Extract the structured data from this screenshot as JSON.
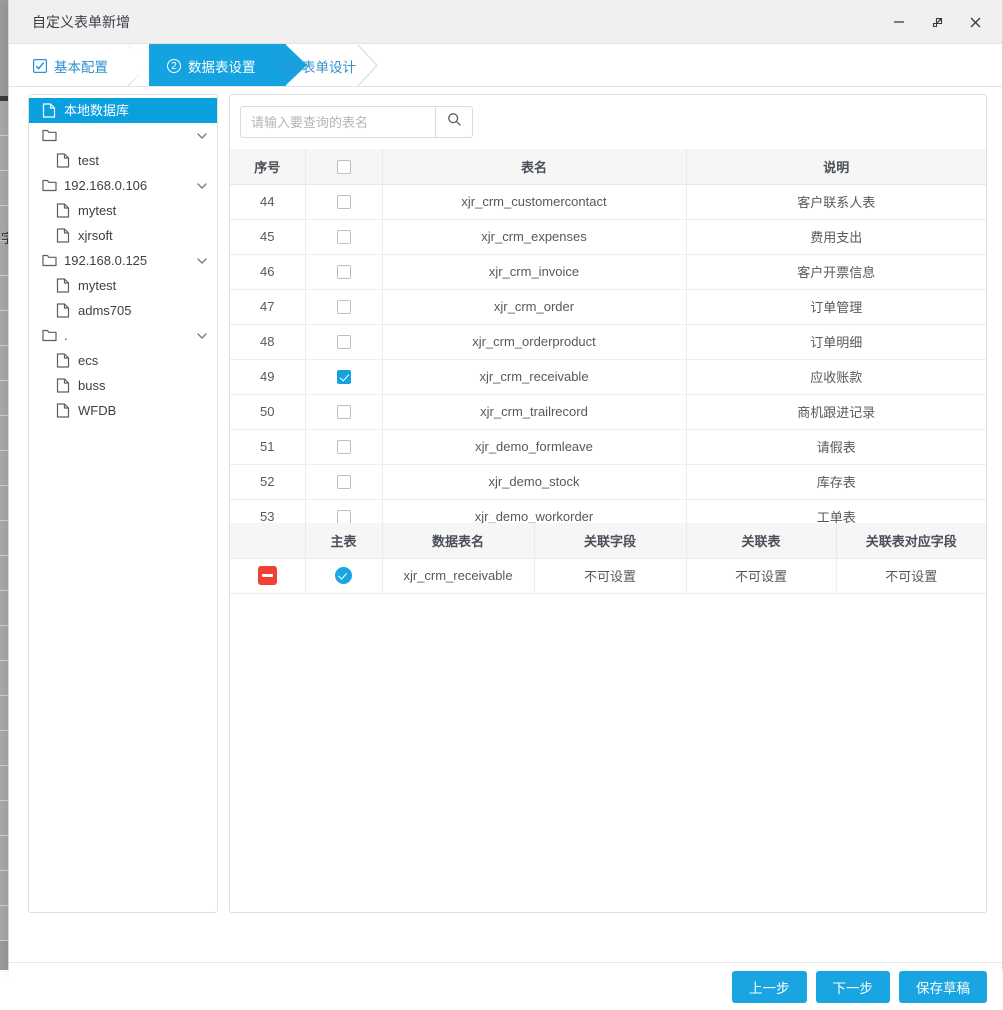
{
  "window": {
    "title": "自定义表单新增",
    "controls": [
      {
        "name": "minimize-button",
        "glyph": "minimize"
      },
      {
        "name": "maximize-button",
        "glyph": "maximize"
      },
      {
        "name": "close-button",
        "glyph": "close"
      }
    ]
  },
  "steps": [
    {
      "label": "基本配置",
      "state": "done",
      "marker": "check"
    },
    {
      "label": "数据表设置",
      "state": "active",
      "marker": "2"
    },
    {
      "label": "表单设计",
      "state": "done",
      "marker": "check"
    }
  ],
  "tree": {
    "items": [
      {
        "label": "本地数据库",
        "icon": "file-icon",
        "level": 0,
        "selected": true,
        "expandable": false
      },
      {
        "label": "",
        "icon": "folder-icon",
        "level": 0,
        "selected": false,
        "expandable": true
      },
      {
        "label": "test",
        "icon": "file-icon",
        "level": 1,
        "selected": false,
        "expandable": false
      },
      {
        "label": "192.168.0.106",
        "icon": "folder-icon",
        "level": 0,
        "selected": false,
        "expandable": true
      },
      {
        "label": "mytest",
        "icon": "file-icon",
        "level": 1,
        "selected": false,
        "expandable": false
      },
      {
        "label": "xjrsoft",
        "icon": "file-icon",
        "level": 1,
        "selected": false,
        "expandable": false
      },
      {
        "label": "192.168.0.125",
        "icon": "folder-icon",
        "level": 0,
        "selected": false,
        "expandable": true
      },
      {
        "label": "mytest",
        "icon": "file-icon",
        "level": 1,
        "selected": false,
        "expandable": false
      },
      {
        "label": "adms705",
        "icon": "file-icon",
        "level": 1,
        "selected": false,
        "expandable": false
      },
      {
        "label": ".",
        "icon": "folder-icon",
        "level": 0,
        "selected": false,
        "expandable": true
      },
      {
        "label": "ecs",
        "icon": "file-icon",
        "level": 1,
        "selected": false,
        "expandable": false
      },
      {
        "label": "buss",
        "icon": "file-icon",
        "level": 1,
        "selected": false,
        "expandable": false
      },
      {
        "label": "WFDB",
        "icon": "file-icon",
        "level": 1,
        "selected": false,
        "expandable": false
      }
    ]
  },
  "search": {
    "placeholder": "请输入要查询的表名",
    "value": "",
    "button_icon": "search-icon"
  },
  "tables_list": {
    "headers": [
      "序号",
      "",
      "表名",
      "说明"
    ],
    "header_checkbox_checked": false,
    "rows": [
      {
        "seq": "44",
        "checked": false,
        "table": "xjr_crm_customercontact",
        "desc": "客户联系人表"
      },
      {
        "seq": "45",
        "checked": false,
        "table": "xjr_crm_expenses",
        "desc": "费用支出"
      },
      {
        "seq": "46",
        "checked": false,
        "table": "xjr_crm_invoice",
        "desc": "客户开票信息"
      },
      {
        "seq": "47",
        "checked": false,
        "table": "xjr_crm_order",
        "desc": "订单管理"
      },
      {
        "seq": "48",
        "checked": false,
        "table": "xjr_crm_orderproduct",
        "desc": "订单明细"
      },
      {
        "seq": "49",
        "checked": true,
        "table": "xjr_crm_receivable",
        "desc": "应收账款"
      },
      {
        "seq": "50",
        "checked": false,
        "table": "xjr_crm_trailrecord",
        "desc": "商机跟进记录"
      },
      {
        "seq": "51",
        "checked": false,
        "table": "xjr_demo_formleave",
        "desc": "请假表"
      },
      {
        "seq": "52",
        "checked": false,
        "table": "xjr_demo_stock",
        "desc": "库存表"
      },
      {
        "seq": "53",
        "checked": false,
        "table": "xjr_demo_workorder",
        "desc": "工单表"
      }
    ]
  },
  "relations": {
    "headers": [
      "",
      "主表",
      "数据表名",
      "关联字段",
      "关联表",
      "关联表对应字段"
    ],
    "rows": [
      {
        "delete_icon": "minus-circle-icon",
        "is_master": true,
        "table_name": "xjr_crm_receivable",
        "relation_field": "不可设置",
        "relation_table": "不可设置",
        "relation_target_field": "不可设置"
      }
    ]
  },
  "footer": {
    "buttons": [
      {
        "label": "上一步",
        "name": "prev-step-button"
      },
      {
        "label": "下一步",
        "name": "next-step-button"
      },
      {
        "label": "保存草稿",
        "name": "save-draft-button"
      }
    ]
  },
  "colors": {
    "accent": "#14a3e0",
    "accent_button": "#18a5e2",
    "danger": "#f04134",
    "titlebar": "#f0f0f0",
    "header_row": "#f6f6f6",
    "muted_text": "#c3c3c3"
  }
}
